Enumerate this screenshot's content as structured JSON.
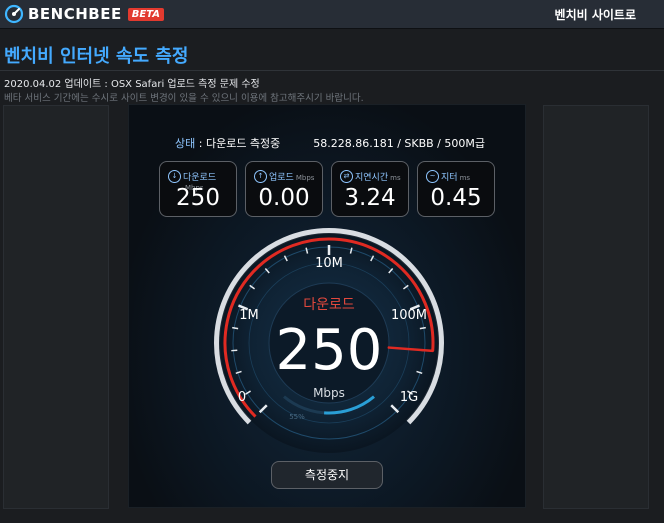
{
  "header": {
    "logo_text": "BENCHBEE",
    "beta_badge": "BETA",
    "site_link": "벤치비 사이트로"
  },
  "page": {
    "title": "벤치비 인터넷 속도 측정",
    "notice": "2020.04.02 업데이트 : OSX Safari 업로드 측정 문제 수정",
    "disclaimer": "베타 서비스 기간에는 수시로 사이트 변경이 있을 수 있으니 이용에 참고해주시기 바랍니다."
  },
  "status": {
    "label": "상태",
    "separator": " : ",
    "value": "다운로드 측정중",
    "server_info": "58.228.86.181 / SKBB / 500M급"
  },
  "metrics": [
    {
      "name": "다운로드",
      "unit": "Mbps",
      "value": "250",
      "icon": "download-icon"
    },
    {
      "name": "업로드",
      "unit": "Mbps",
      "value": "0.00",
      "icon": "upload-icon"
    },
    {
      "name": "지연시간",
      "unit": "ms",
      "value": "3.24",
      "icon": "latency-icon"
    },
    {
      "name": "지터",
      "unit": "ms",
      "value": "0.45",
      "icon": "jitter-icon"
    }
  ],
  "gauge": {
    "mode_label": "다운로드",
    "speed": "250",
    "unit": "Mbps",
    "progress_text": "55%",
    "progress_fraction": 0.55,
    "scale_labels": {
      "zero": "0",
      "one_m": "1M",
      "ten_m": "10M",
      "hundred_m": "100M",
      "one_g": "1G"
    },
    "accent_color": "#e02a22",
    "progress_color": "#2a9fd6"
  },
  "actions": {
    "stop_label": "측정중지"
  }
}
